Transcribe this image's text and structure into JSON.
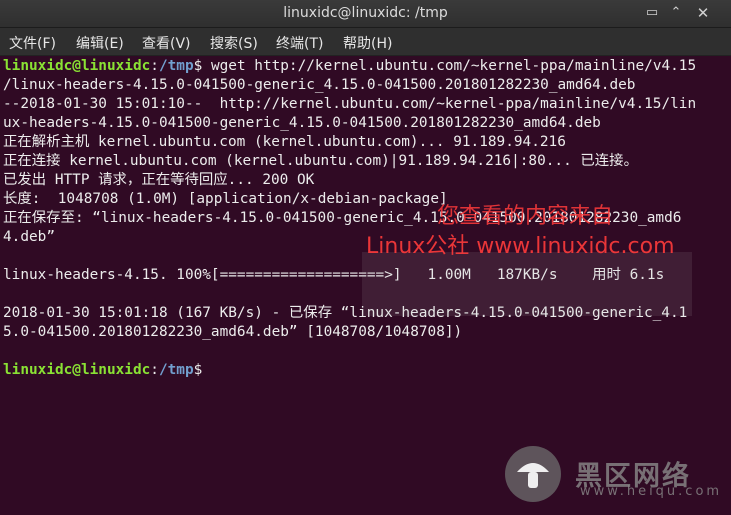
{
  "window": {
    "title": "linuxidc@linuxidc: /tmp",
    "controls": {
      "minimize": "▭",
      "maximize": "⌃",
      "close": "✕"
    }
  },
  "menu": [
    "文件(F)",
    "编辑(E)",
    "查看(V)",
    "搜索(S)",
    "终端(T)",
    "帮助(H)"
  ],
  "terminal": {
    "prompt_user": "linuxidc@linuxidc",
    "prompt_path": "/tmp",
    "prompt_symbol": "$",
    "command": " wget http://kernel.ubuntu.com/~kernel-ppa/mainline/v4.15",
    "lines": [
      "/linux-headers-4.15.0-041500-generic_4.15.0-041500.201801282230_amd64.deb",
      "--2018-01-30 15:01:10--  http://kernel.ubuntu.com/~kernel-ppa/mainline/v4.15/lin",
      "ux-headers-4.15.0-041500-generic_4.15.0-041500.201801282230_amd64.deb",
      "正在解析主机 kernel.ubuntu.com (kernel.ubuntu.com)... 91.189.94.216",
      "正在连接 kernel.ubuntu.com (kernel.ubuntu.com)|91.189.94.216|:80... 已连接。",
      "已发出 HTTP 请求，正在等待回应... 200 OK",
      "长度:  1048708 (1.0M) [application/x-debian-package]",
      "正在保存至: “linux-headers-4.15.0-041500-generic_4.15.0-041500.201801282230_amd6",
      "4.deb”",
      "",
      "linux-headers-4.15. 100%[===================>]   1.00M   187KB/s    用时 6.1s",
      "",
      "2018-01-30 15:01:18 (167 KB/s) - 已保存 “linux-headers-4.15.0-041500-generic_4.1",
      "5.0-041500.201801282230_amd64.deb” [1048708/1048708])",
      ""
    ]
  },
  "watermark": {
    "line1": "您查看的内容来自",
    "line2": "Linux公社 www.linuxidc.com",
    "logo_cn": "黑区网络",
    "logo_url": "www.heiqu.com"
  },
  "colors": {
    "background": "#300a24",
    "prompt_user": "#8ae234",
    "prompt_path": "#729fcf",
    "watermark": "#ff3b3b"
  }
}
